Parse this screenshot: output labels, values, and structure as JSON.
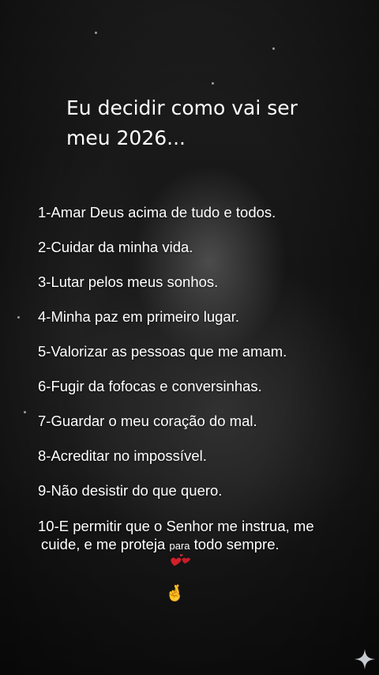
{
  "title": {
    "line1": "Eu decidir como vai ser",
    "line2": "meu 2026..."
  },
  "items": [
    "1-Amar Deus acima de tudo e todos.",
    "2-Cuidar da minha vida.",
    "3-Lutar pelos meus sonhos.",
    "4-Minha paz em primeiro lugar.",
    "5-Valorizar as pessoas que me amam.",
    "6-Fugir da fofocas e conversinhas.",
    "7-Guardar o meu coração do mal.",
    "8-Acreditar no impossível.",
    "9-Não desistir do que quero."
  ],
  "last_item": {
    "line1": "10-E permitir que o Senhor me instrua, me",
    "line2_a": "cuide, e me proteja",
    "line2_small": "para",
    "line2_b": "todo sempre."
  },
  "emojis": {
    "hearts": "hearts-emoji",
    "hand": "🤞",
    "corner": "sparkle-icon"
  },
  "colors": {
    "text": "#ffffff",
    "heart": "#d2202a"
  }
}
